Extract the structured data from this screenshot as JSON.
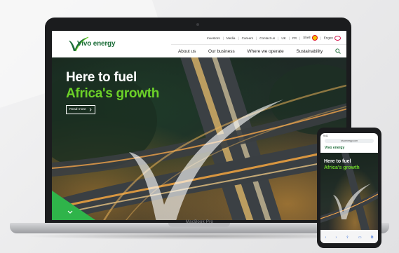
{
  "site": {
    "logo_text": "Vivo energy",
    "top_links": [
      "Investors",
      "Media",
      "Careers",
      "Contact us",
      "UK",
      "FR",
      "Shell",
      "Engen"
    ],
    "nav": [
      "About us",
      "Our business",
      "Where we operate",
      "Sustainability"
    ]
  },
  "hero": {
    "line1": "Here to fuel",
    "line2": "Africa's growth",
    "read_more": "Read more"
  },
  "laptop": {
    "label": "MacBook Pro"
  },
  "phone": {
    "status_time": "9:41",
    "url": "vivoenergy.com",
    "logo_text": "Vivo energy",
    "hero_line1": "Here to fuel",
    "hero_line2": "Africa's growth",
    "toolbar_icons": [
      "back-icon",
      "forward-icon",
      "share-icon",
      "bookmarks-icon",
      "tabs-icon"
    ]
  },
  "colors": {
    "brand_green": "#6cd128",
    "logo_green": "#1d6e3a",
    "bezel": "#1b1c1e"
  }
}
